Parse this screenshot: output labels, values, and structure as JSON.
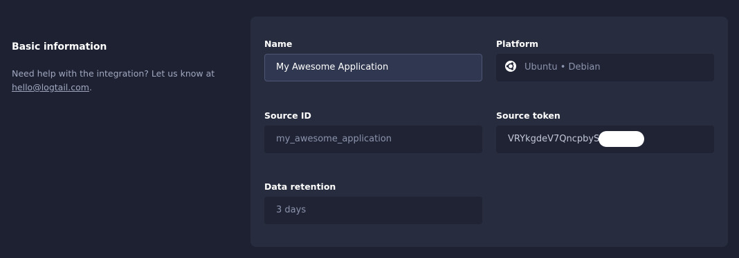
{
  "section": {
    "title": "Basic information",
    "help_text": "Need help with the integration? Let us know at",
    "help_email": "hello@logtail.com",
    "help_suffix": "."
  },
  "fields": {
    "name": {
      "label": "Name",
      "value": "My Awesome Application"
    },
    "platform": {
      "label": "Platform",
      "value": "Ubuntu • Debian",
      "icon": "ubuntu-icon"
    },
    "source_id": {
      "label": "Source ID",
      "value": "my_awesome_application"
    },
    "source_token": {
      "label": "Source token",
      "value": "VRYkgdeV7QncpbySr"
    },
    "data_retention": {
      "label": "Data retention",
      "value": "3 days"
    }
  },
  "colors": {
    "background": "#1d2131",
    "card": "#272d3e",
    "field": "#1f2334",
    "input": "#303851",
    "muted_text": "#a1a8c0"
  }
}
